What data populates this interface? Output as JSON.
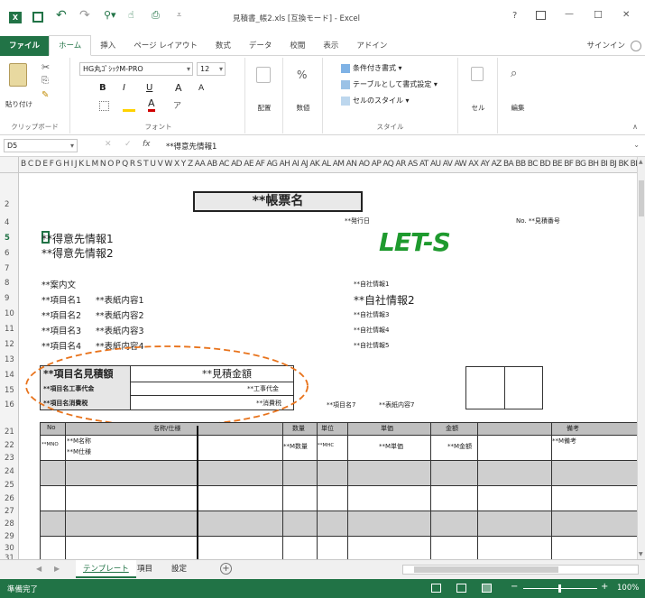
{
  "titlebar": {
    "title": "見積書_帳2.xls [互換モード] - Excel",
    "help": "?",
    "minimize": "—",
    "maximize": "☐",
    "close": "✕"
  },
  "tabs": [
    "ファイル",
    "ホーム",
    "挿入",
    "ページ レイアウト",
    "数式",
    "データ",
    "校閲",
    "表示",
    "アドイン"
  ],
  "signin": "サインイン",
  "ribbon": {
    "clipboard": {
      "label": "クリップボード",
      "paste": "貼り付け"
    },
    "font": {
      "label": "フォント",
      "name": "HG丸ｺﾞｼｯｸM-PRO",
      "size": "12",
      "bold": "B",
      "italic": "I",
      "underline": "U",
      "grow": "A",
      "shrink": "A"
    },
    "align": {
      "label": "配置"
    },
    "number": {
      "label": "数値",
      "pct": "%"
    },
    "styles": {
      "label": "スタイル",
      "cond": "条件付き書式 ▾",
      "table": "テーブルとして書式設定 ▾",
      "cell": "セルのスタイル ▾"
    },
    "cells": {
      "label": "セル"
    },
    "editing": {
      "label": "編集"
    }
  },
  "formula": {
    "namebox": "D5",
    "fx": "fx",
    "value": "**得意先情報1"
  },
  "columns": "B C D E F G H I J K L M N O P Q R S T U V W X Y Z AA AB AC AD AE AF AG AH AI AJ AK AL AM AN AO AP AQ AR AS AT AU AV AW AX AY AZ BA BB BC BD BE BF BG BH BI BJ BK BL BM BN BO BP BQ BR BS BT BU BV BW BX BY BZ",
  "rows": [
    "2",
    "4",
    "5",
    "6",
    "7",
    "8",
    "9",
    "10",
    "11",
    "12",
    "13",
    "14",
    "15",
    "16",
    "21",
    "22",
    "23",
    "24",
    "25",
    "26",
    "27",
    "28",
    "29",
    "30",
    "31"
  ],
  "sheet": {
    "title": "**帳票名",
    "issue_date": "**発行日",
    "no": "No.  **見積番号",
    "cust1": "**得意先情報1",
    "cust2": "**得意先情報2",
    "logo": "LET-S",
    "guide": "**案内文",
    "items": [
      {
        "name": "**項目名1",
        "val": "**表紙内容1"
      },
      {
        "name": "**項目名2",
        "val": "**表紙内容2"
      },
      {
        "name": "**項目名3",
        "val": "**表紙内容3"
      },
      {
        "name": "**項目名4",
        "val": "**表紙内容4"
      }
    ],
    "company": [
      "**自社情報1",
      "**自社情報2",
      "**自社情報3",
      "**自社情報4",
      "**自社情報5"
    ],
    "box": {
      "name": "**項目名見積額",
      "amount": "**見積金額",
      "r2l": "**項目名工事代金",
      "r2v": "**工事代金",
      "r3l": "**項目名消費税",
      "r3v": "**消費税"
    },
    "item7": "**項目名7",
    "val7": "**表紙内容7",
    "headers": [
      "No",
      "名称/仕様",
      "数量",
      "単位",
      "単価",
      "金額",
      "備考"
    ],
    "row": {
      "no": "**MNO",
      "name": "**M名称",
      "spec": "**M仕様",
      "qty": "**M数量",
      "unit": "**MHC",
      "price": "**M単価",
      "amt": "**M金額",
      "note": "**M備考"
    }
  },
  "sheettabs": [
    "テンプレート",
    "項目",
    "設定"
  ],
  "status": {
    "ready": "準備完了",
    "zoom": "100%"
  }
}
